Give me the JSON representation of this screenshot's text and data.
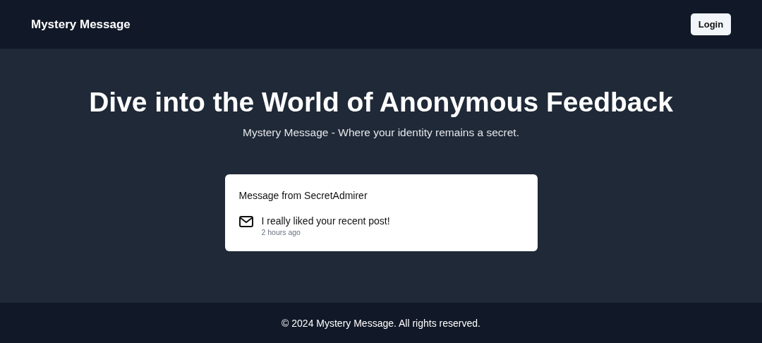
{
  "header": {
    "brand": "Mystery Message",
    "login_button": "Login"
  },
  "hero": {
    "title": "Dive into the World of Anonymous Feedback",
    "subtitle": "Mystery Message - Where your identity remains a secret."
  },
  "messages": [
    {
      "title": "Message from SecretAdmirer",
      "content": "I really liked your recent post!",
      "time": "2 hours ago"
    }
  ],
  "footer": {
    "text": "© 2024 Mystery Message. All rights reserved."
  }
}
